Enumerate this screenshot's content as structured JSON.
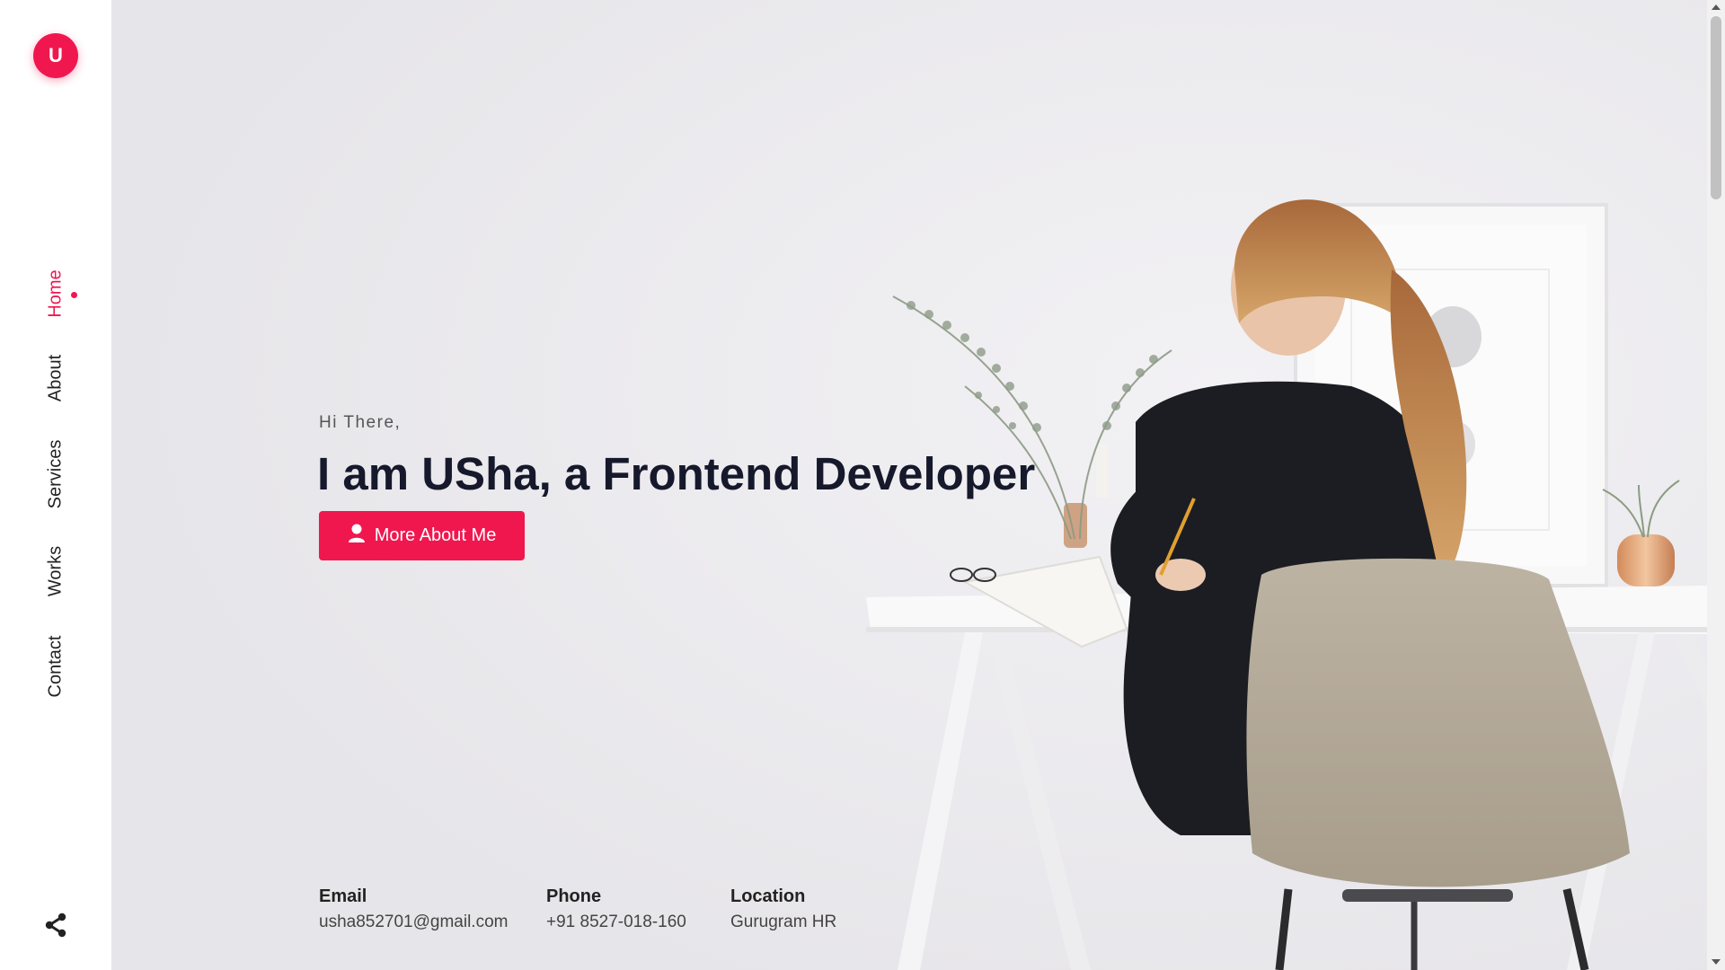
{
  "brand": {
    "logo_letter": "U",
    "accent": "#f0174f"
  },
  "nav": {
    "items": [
      {
        "label": "Home",
        "active": true
      },
      {
        "label": "About",
        "active": false
      },
      {
        "label": "Services",
        "active": false
      },
      {
        "label": "Works",
        "active": false
      },
      {
        "label": "Contact",
        "active": false
      }
    ],
    "share_icon": "share-icon"
  },
  "hero": {
    "greeting": "Hi There,",
    "headline": "I am USha, a Frontend Developer",
    "cta_label": "More About Me",
    "cta_icon": "user-icon"
  },
  "contact": {
    "email_label": "Email",
    "email_value": "usha852701@gmail.com",
    "phone_label": "Phone",
    "phone_value": "+91 8527-018-160",
    "location_label": "Location",
    "location_value": "Gurugram HR"
  }
}
